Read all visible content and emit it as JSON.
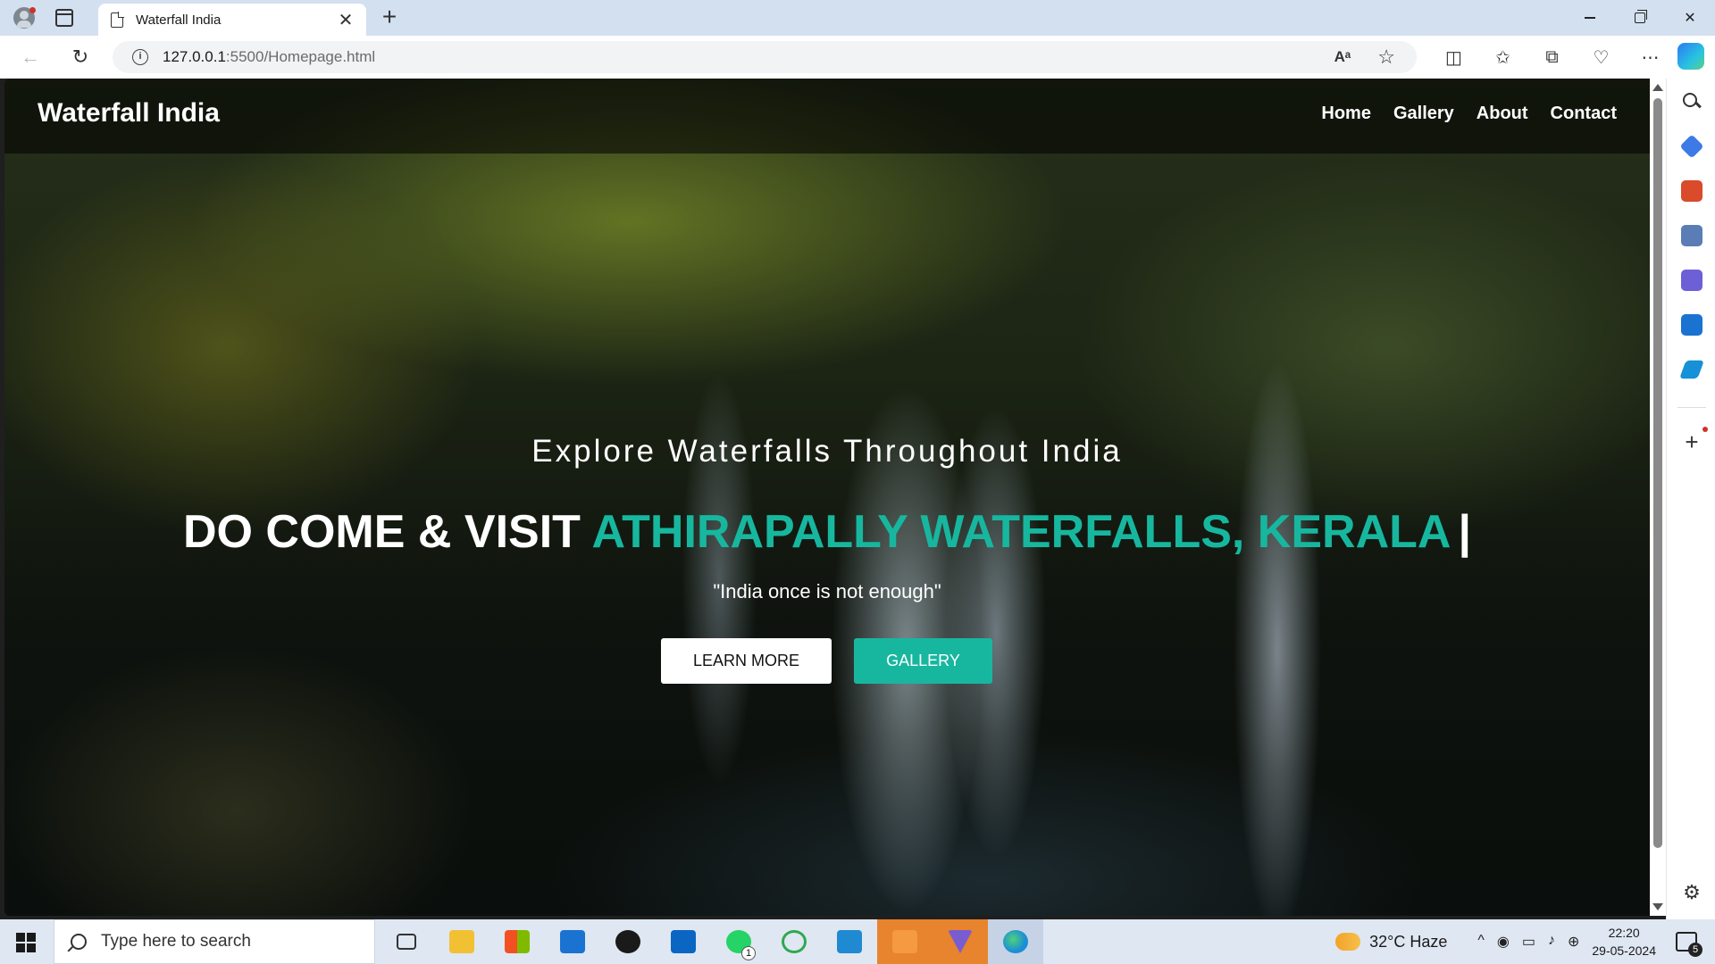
{
  "browser": {
    "tab_title": "Waterfall India",
    "tab_close": "✕",
    "new_tab": "+",
    "url_host": "127.0.0.1",
    "url_rest": ":5500/Homepage.html",
    "read_aloud": "Aᵃ",
    "favorite": "☆"
  },
  "site": {
    "logo": "Waterfall India",
    "nav": [
      "Home",
      "Gallery",
      "About",
      "Contact"
    ]
  },
  "hero": {
    "kicker": "Explore Waterfalls Throughout India",
    "headline_white": "DO COME & VISIT",
    "headline_accent": "ATHIRAPALLY WATERFALLS, KERALA",
    "cursor": "|",
    "quote": "\"India once is not enough\"",
    "btn_learn": "LEARN MORE",
    "btn_gallery": "GALLERY",
    "accent_color": "#17b79f"
  },
  "taskbar": {
    "search_placeholder": "Type here to search",
    "whatsapp_badge": "1",
    "weather": "32°C  Haze",
    "time": "22:20",
    "date": "29-05-2024",
    "notification_count": "5"
  }
}
